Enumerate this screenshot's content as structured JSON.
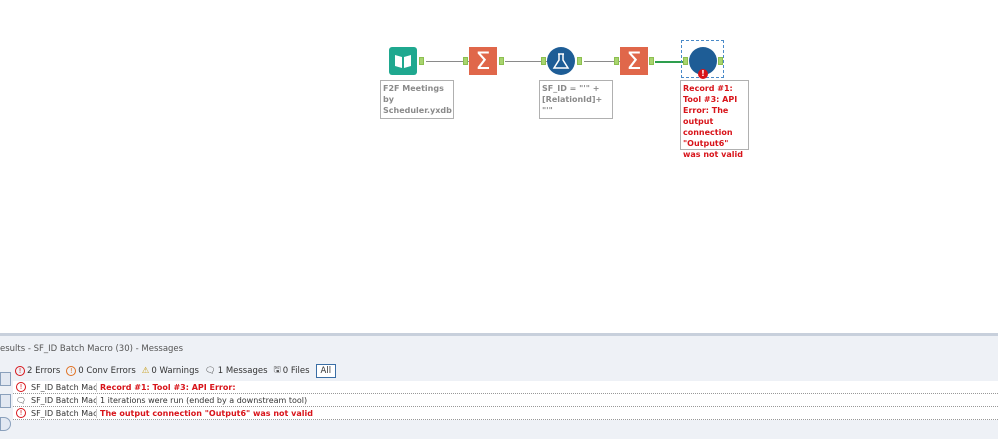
{
  "workflow": {
    "tools": [
      {
        "name": "input-data",
        "label": "F2F Meetings by Scheduler.yxdb"
      },
      {
        "name": "summarize-1"
      },
      {
        "name": "formula",
        "label": "SF_ID = \"'\" + [RelationId]+ \"'\""
      },
      {
        "name": "summarize-2"
      },
      {
        "name": "batch-macro",
        "label": "Record #1: Tool #3: API Error: The output connection \"Output6\" was not valid"
      }
    ]
  },
  "results": {
    "title": "esults - SF_ID Batch Macro (30) - Messages",
    "filters": {
      "errors": "2 Errors",
      "conv_errors": "0 Conv Errors",
      "warnings": "0 Warnings",
      "messages": "1 Messages",
      "files": "0 Files",
      "all": "All"
    },
    "rows": [
      {
        "type": "error",
        "source": "SF_ID Batch Macr",
        "message": "Record #1: Tool #3: API Error:"
      },
      {
        "type": "message",
        "source": "SF_ID Batch Macr",
        "message": "1 iterations were run (ended by a downstream tool)"
      },
      {
        "type": "error",
        "source": "SF_ID Batch Macr",
        "message": "The output connection \"Output6\" was not valid"
      }
    ]
  },
  "colors": {
    "error": "#d8141a",
    "sigma": "#e0674a",
    "teal": "#1fa88f",
    "blue": "#1e5d96"
  }
}
